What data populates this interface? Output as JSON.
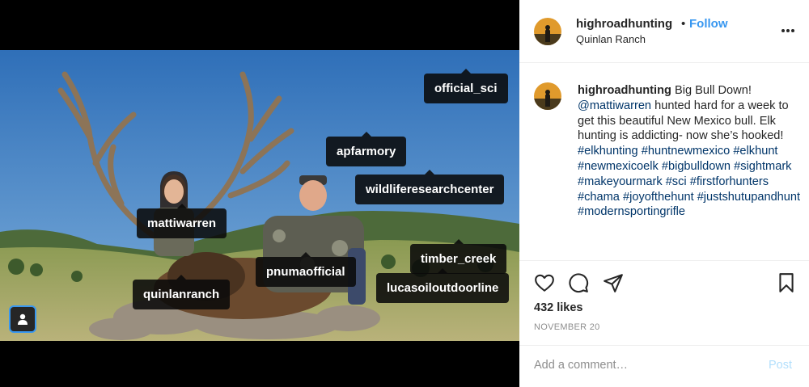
{
  "post": {
    "username": "highroadhunting",
    "separator": "•",
    "follow_label": "Follow",
    "location": "Quinlan Ranch",
    "more_icon": "more-options-icon"
  },
  "caption": {
    "username": "highroadhunting",
    "text_1": " Big Bull Down! ",
    "mention": "@mattiwarren",
    "text_2": " hunted hard for a week to get this beautiful New Mexico bull. Elk hunting is addicting- now she’s hooked! ",
    "hashtags": [
      "#elkhunting",
      "#huntnewmexico",
      "#elkhunt",
      "#newmexicoelk",
      "#bigbulldown",
      "#sightmark",
      "#makeyourmark",
      "#sci",
      "#firstforhunters",
      "#chama",
      "#joyofthehunt",
      "#justshutupandhunt",
      "#modernsportingrifle"
    ]
  },
  "tags": {
    "official_sci": "official_sci",
    "apfarmory": "apfarmory",
    "wildliferesearchcenter": "wildliferesearchcenter",
    "mattiwarren": "mattiwarren",
    "timber_creek": "timber_creek",
    "pnumaofficial": "pnumaofficial",
    "lucasoiloutdoorline": "lucasoiloutdoorline",
    "quinlanranch": "quinlanranch"
  },
  "stats": {
    "likes": "432 likes",
    "date": "NOVEMBER 20"
  },
  "comment": {
    "placeholder": "Add a comment…",
    "post_label": "Post"
  },
  "colors": {
    "accent": "#3897f0",
    "link": "#003569",
    "post_disabled": "#b2dffc"
  }
}
